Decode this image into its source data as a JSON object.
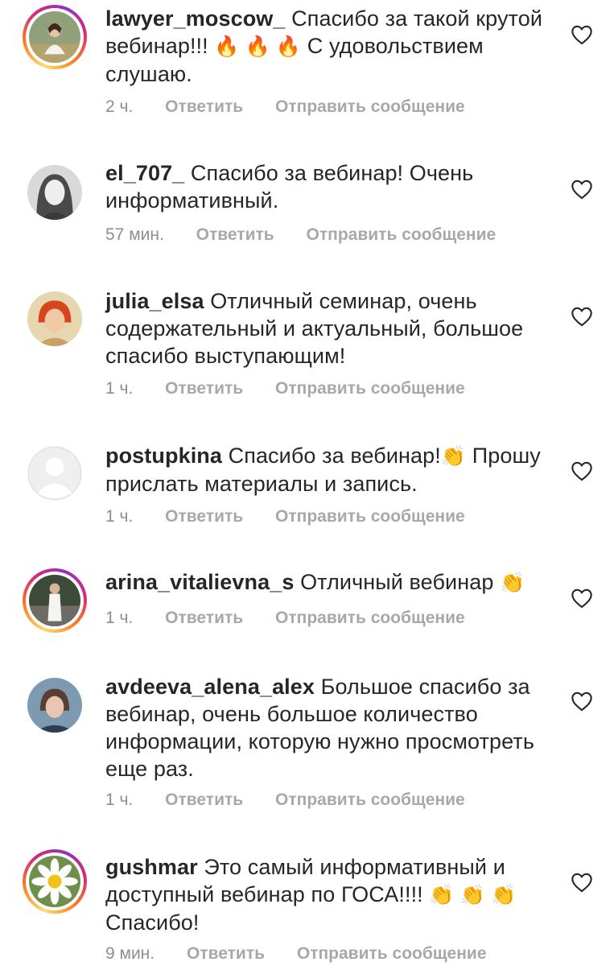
{
  "actions": {
    "reply_label": "Ответить",
    "send_message_label": "Отправить сообщение"
  },
  "icons": {
    "like": "heart-outline-icon",
    "default_avatar": "default-avatar-icon"
  },
  "colors": {
    "text": "#262626",
    "meta": "#8e8e8e",
    "story_ring": [
      "#feda75",
      "#fa7e1e",
      "#d62976",
      "#962fbf"
    ]
  },
  "comments": [
    {
      "username": "lawyer_moscow_",
      "text_before": "Спасибо за такой крутой вебинар!!!",
      "emojis": "🔥 🔥 🔥",
      "text_after": "С удовольствием слушаю.",
      "time": "2 ч."
    },
    {
      "username": "el_707_",
      "text": "Спасибо за вебинар! Очень информативный.",
      "time": "57 мин."
    },
    {
      "username": "julia_elsa",
      "text": "Отличный семинар, очень содержательный и актуальный, большое спасибо выступающим!",
      "time": "1 ч."
    },
    {
      "username": "postupkina",
      "text_before": "Спасибо за вебинар!",
      "emojis": "👏",
      "text_after": "Прошу прислать материалы и запись.",
      "time": "1 ч."
    },
    {
      "username": "arina_vitalievna_s",
      "text": "Отличный вебинар",
      "emojis": "👏",
      "time": "1 ч."
    },
    {
      "username": "avdeeva_alena_alex",
      "text": "Большое спасибо за вебинар, очень большое количество информации, которую нужно просмотреть еще раз.",
      "time": "1 ч."
    },
    {
      "username": "gushmar",
      "text_before": "Это самый информативный и доступный вебинар по ГОСА!!!!",
      "emojis": "👏 👏 👏",
      "text_after": "Спасибо!",
      "time": "9 мин."
    }
  ]
}
